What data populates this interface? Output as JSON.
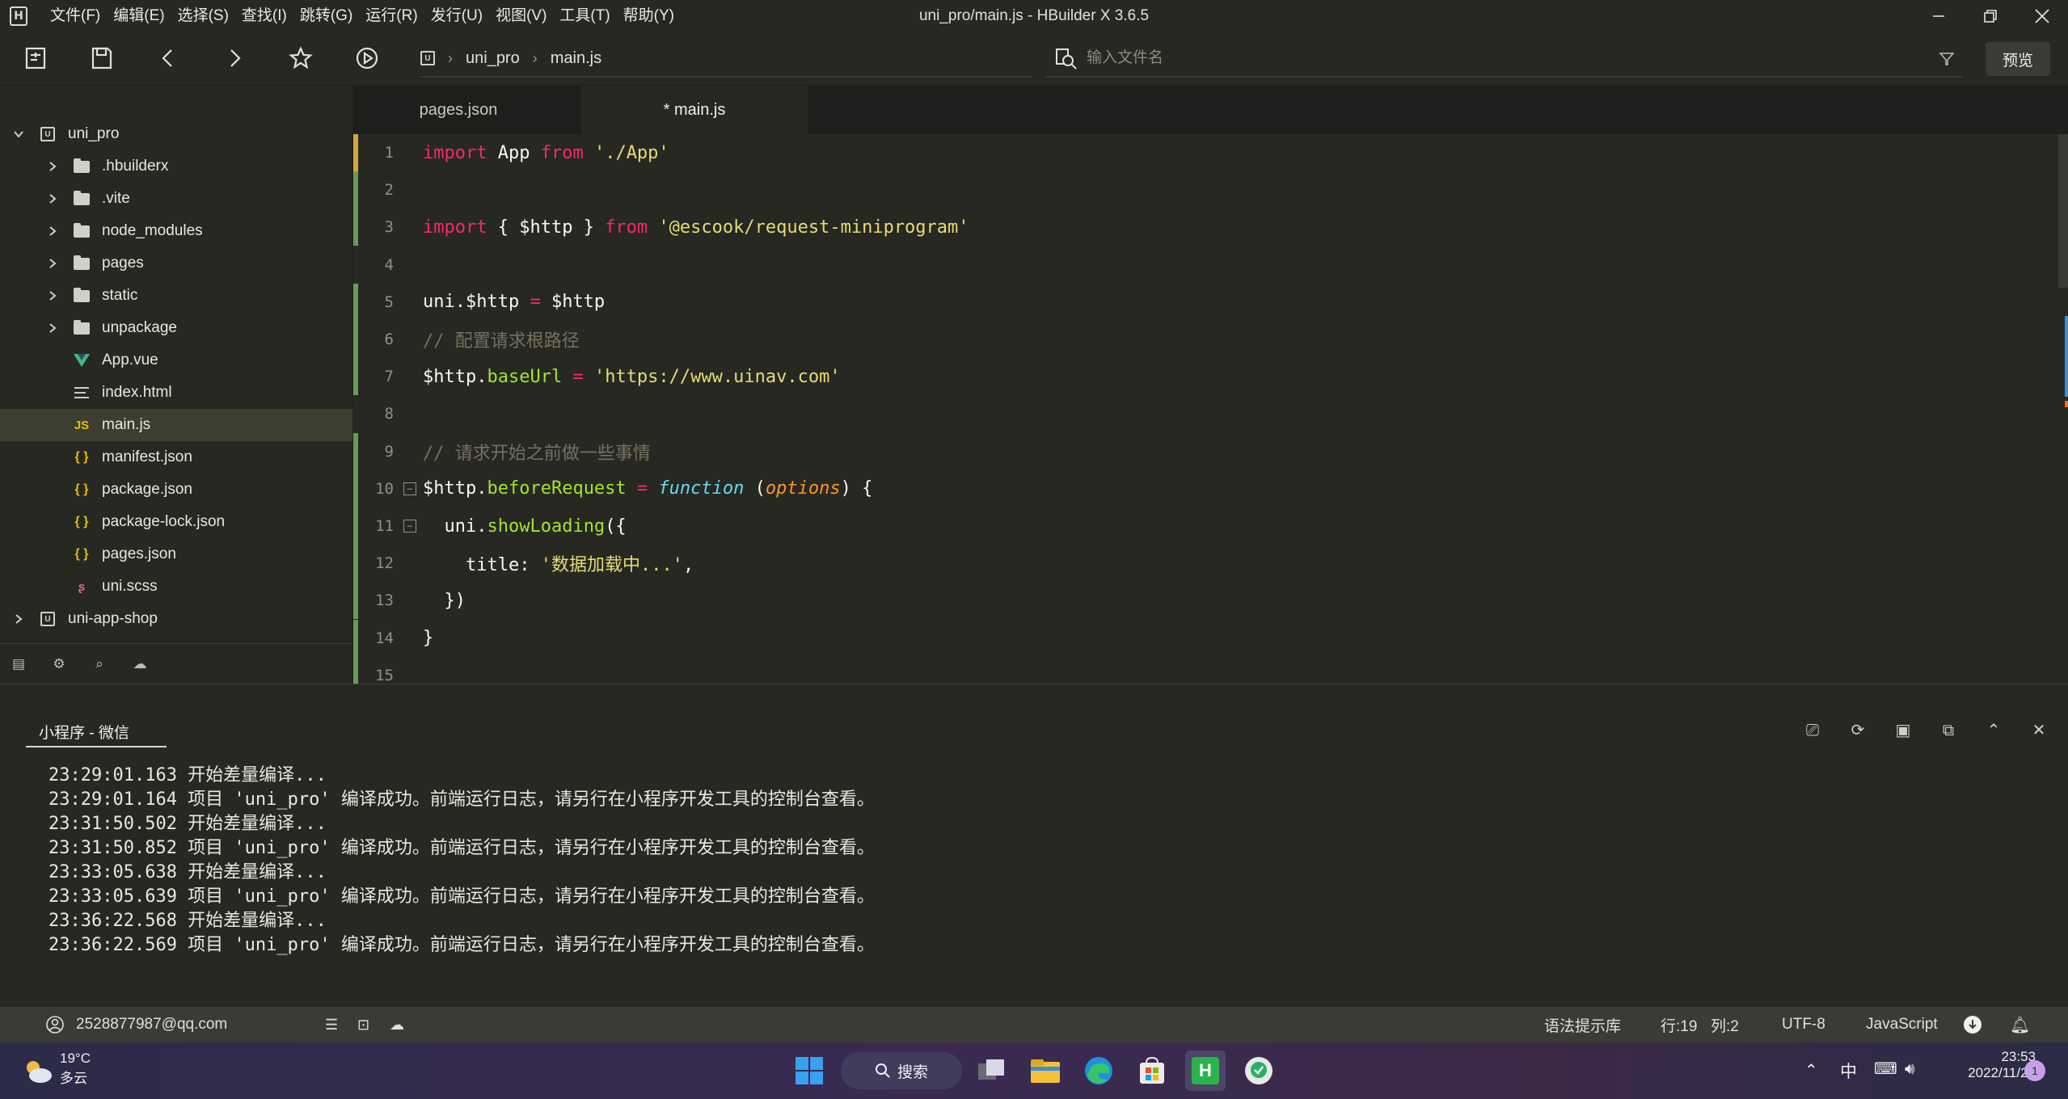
{
  "window": {
    "title": "uni_pro/main.js - HBuilder X 3.6.5",
    "logo_letter": "H"
  },
  "menu": [
    "文件(F)",
    "编辑(E)",
    "选择(S)",
    "查找(I)",
    "跳转(G)",
    "运行(R)",
    "发行(U)",
    "视图(V)",
    "工具(T)",
    "帮助(Y)"
  ],
  "toolbar": {
    "breadcrumb": [
      "uni_pro",
      "main.js"
    ],
    "file_search_placeholder": "输入文件名",
    "preview_label": "预览"
  },
  "sidebar": {
    "root_project": "uni_pro",
    "items": [
      {
        "label": ".hbuilderx",
        "type": "folder"
      },
      {
        "label": ".vite",
        "type": "folder"
      },
      {
        "label": "node_modules",
        "type": "folder"
      },
      {
        "label": "pages",
        "type": "folder"
      },
      {
        "label": "static",
        "type": "folder"
      },
      {
        "label": "unpackage",
        "type": "folder"
      },
      {
        "label": "App.vue",
        "type": "vue"
      },
      {
        "label": "index.html",
        "type": "html"
      },
      {
        "label": "main.js",
        "type": "js",
        "selected": true
      },
      {
        "label": "manifest.json",
        "type": "json"
      },
      {
        "label": "package.json",
        "type": "json"
      },
      {
        "label": "package-lock.json",
        "type": "json"
      },
      {
        "label": "pages.json",
        "type": "json"
      },
      {
        "label": "uni.scss",
        "type": "scss"
      }
    ],
    "second_project": "uni-app-shop",
    "js_badge": "JS",
    "json_badge": "{ }"
  },
  "tabs": [
    {
      "label": "pages.json",
      "active": false
    },
    {
      "label": "* main.js",
      "active": true
    }
  ],
  "editor": {
    "line_numbers": [
      "1",
      "2",
      "3",
      "4",
      "5",
      "6",
      "7",
      "8",
      "9",
      "10",
      "11",
      "12",
      "13",
      "14",
      "15"
    ],
    "lines": [
      "import App from './App'",
      "",
      "import { $http } from '@escook/request-miniprogram'",
      "",
      "uni.$http = $http",
      "// 配置请求根路径",
      "$http.baseUrl = 'https://www.uinav.com'",
      "",
      "// 请求开始之前做一些事情",
      "$http.beforeRequest = function (options) {",
      "  uni.showLoading({",
      "    title: '数据加载中...',",
      "  })",
      "}",
      ""
    ],
    "colors": {
      "keyword": "#f92672",
      "string": "#e6db74",
      "function": "#a6e22e",
      "comment": "#75715e"
    }
  },
  "console": {
    "tab_label": "小程序 - 微信",
    "logs": [
      "23:29:01.163 开始差量编译...",
      "23:29:01.164 项目 'uni_pro' 编译成功。前端运行日志，请另行在小程序开发工具的控制台查看。",
      "23:31:50.502 开始差量编译...",
      "23:31:50.852 项目 'uni_pro' 编译成功。前端运行日志，请另行在小程序开发工具的控制台查看。",
      "23:33:05.638 开始差量编译...",
      "23:33:05.639 项目 'uni_pro' 编译成功。前端运行日志，请另行在小程序开发工具的控制台查看。",
      "23:36:22.568 开始差量编译...",
      "23:36:22.569 项目 'uni_pro' 编译成功。前端运行日志，请另行在小程序开发工具的控制台查看。"
    ]
  },
  "statusbar": {
    "account": "2528877987@qq.com",
    "syntax_hint": "语法提示库",
    "line": "行:19",
    "col": "列:2",
    "encoding": "UTF-8",
    "language": "JavaScript"
  },
  "taskbar": {
    "weather_temp": "19°C",
    "weather_desc": "多云",
    "search_label": "搜索",
    "ime": "中",
    "time": "23:53",
    "date": "2022/11/21",
    "notification_count": "1"
  }
}
